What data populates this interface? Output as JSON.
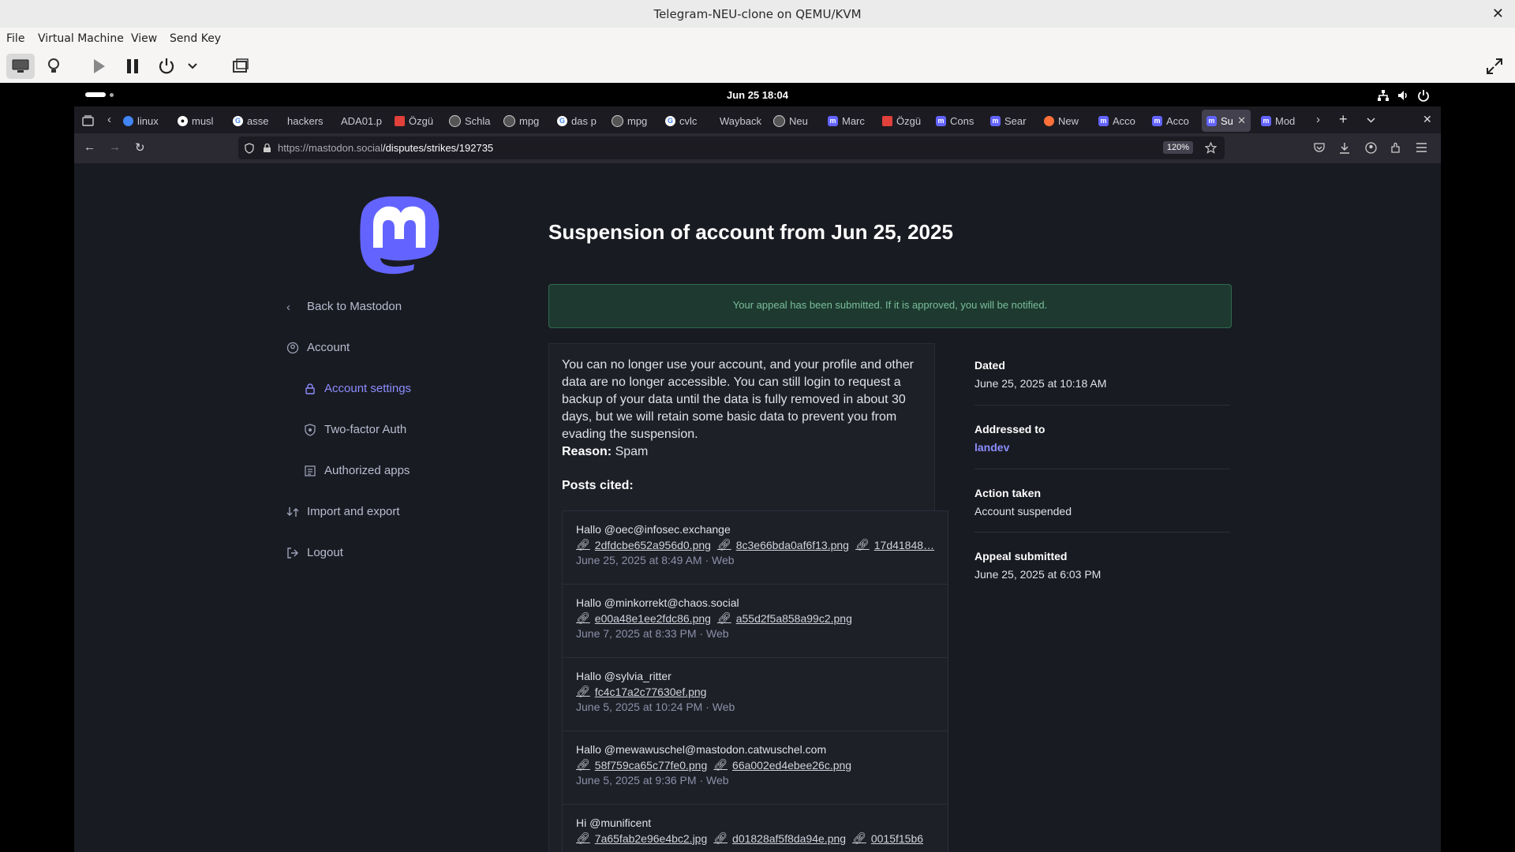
{
  "vm": {
    "title": "Telegram-NEU-clone on QEMU/KVM",
    "menu": [
      "File",
      "Virtual Machine",
      "View",
      "Send Key"
    ]
  },
  "gnome": {
    "clock": "Jun 25  18:04"
  },
  "browser": {
    "tabs": [
      {
        "label": "linux",
        "icon": "chrome-icon",
        "color": "#4285f4"
      },
      {
        "label": "musl",
        "icon": "github-icon",
        "color": "#ffffff"
      },
      {
        "label": "asse",
        "icon": "google-icon",
        "color": "#4285f4"
      },
      {
        "label": "hackers",
        "icon": "",
        "color": ""
      },
      {
        "label": "ADA01.p",
        "icon": "",
        "color": ""
      },
      {
        "label": "Özgü",
        "icon": "shield-icon",
        "color": "#e0413b"
      },
      {
        "label": "Schla",
        "icon": "globe-icon",
        "color": "#cccccc"
      },
      {
        "label": "mpg",
        "icon": "globe-icon",
        "color": "#cccccc"
      },
      {
        "label": "das p",
        "icon": "google-icon",
        "color": "#4285f4"
      },
      {
        "label": "mpg",
        "icon": "globe-icon",
        "color": "#cccccc"
      },
      {
        "label": "cvlc",
        "icon": "google-icon",
        "color": "#4285f4"
      },
      {
        "label": "Wayback",
        "icon": "",
        "color": ""
      },
      {
        "label": "Neu",
        "icon": "globe-icon",
        "color": "#cccccc"
      },
      {
        "label": "Marc",
        "icon": "mastodon-icon",
        "color": "#6364ff"
      },
      {
        "label": "Özgü",
        "icon": "shield-icon",
        "color": "#e0413b"
      },
      {
        "label": "Cons",
        "icon": "mastodon-icon",
        "color": "#6364ff"
      },
      {
        "label": "Sear",
        "icon": "mastodon-icon",
        "color": "#6364ff"
      },
      {
        "label": "New",
        "icon": "firefox-icon",
        "color": "#ff7139"
      },
      {
        "label": "Acco",
        "icon": "mastodon-icon",
        "color": "#6364ff"
      },
      {
        "label": "Acco",
        "icon": "mastodon-icon",
        "color": "#6364ff"
      },
      {
        "label": "Su",
        "icon": "mastodon-icon",
        "color": "#6364ff",
        "active": true
      },
      {
        "label": "Mod",
        "icon": "mastodon-icon",
        "color": "#6364ff"
      }
    ],
    "url_host": "https://mastodon.social",
    "url_path": "/disputes/strikes/192735",
    "zoom": "120%"
  },
  "sidebar": {
    "back": "Back to Mastodon",
    "account": "Account",
    "account_settings": "Account settings",
    "two_factor": "Two-factor Auth",
    "authorized_apps": "Authorized apps",
    "import_export": "Import and export",
    "logout": "Logout"
  },
  "main": {
    "title": "Suspension of account from Jun 25, 2025",
    "flash": "Your appeal has been submitted. If it is approved, you will be notified.",
    "body": "You can no longer use your account, and your profile and other data are no longer accessible. You can still login to request a backup of your data until the data is fully removed in about 30 days, but we will retain some basic data to prevent you from evading the suspension.",
    "reason_label": "Reason:",
    "reason_value": "Spam",
    "posts_cited": "Posts cited:",
    "posts": [
      {
        "text": "Hallo @oec@infosec.exchange",
        "links": [
          "2dfdcbe652a956d0.png",
          "8c3e66bda0af6f13.png",
          "17d41848…"
        ],
        "meta": "June 25, 2025 at 8:49 AM · Web"
      },
      {
        "text": "Hallo @minkorrekt@chaos.social",
        "links": [
          "e00a48e1ee2fdc86.png",
          "a55d2f5a858a99c2.png"
        ],
        "meta": "June 7, 2025 at 8:33 PM · Web"
      },
      {
        "text": "Hallo @sylvia_ritter",
        "links": [
          "fc4c17a2c77630ef.png"
        ],
        "meta": "June 5, 2025 at 10:24 PM · Web"
      },
      {
        "text": "Hallo @mewawuschel@mastodon.catwuschel.com",
        "links": [
          "58f759ca65c77fe0.png",
          "66a002ed4ebee26c.png"
        ],
        "meta": "June 5, 2025 at 9:36 PM · Web"
      },
      {
        "text": "Hi @munificent",
        "links": [
          "7a65fab2e96e4bc2.jpg",
          "d01828af5f8da94e.png",
          "0015f15b6"
        ],
        "meta": ""
      }
    ],
    "meta": {
      "dated_label": "Dated",
      "dated_value": "June 25, 2025 at 10:18 AM",
      "addressed_label": "Addressed to",
      "addressed_value": "landev",
      "action_label": "Action taken",
      "action_value": "Account suspended",
      "appeal_label": "Appeal submitted",
      "appeal_value": "June 25, 2025 at 6:03 PM"
    }
  },
  "colors": {
    "accent": "#8c8dff",
    "flash_bg": "#1e3a30",
    "flash_text": "#79bd9a",
    "page_bg": "#191b22"
  }
}
